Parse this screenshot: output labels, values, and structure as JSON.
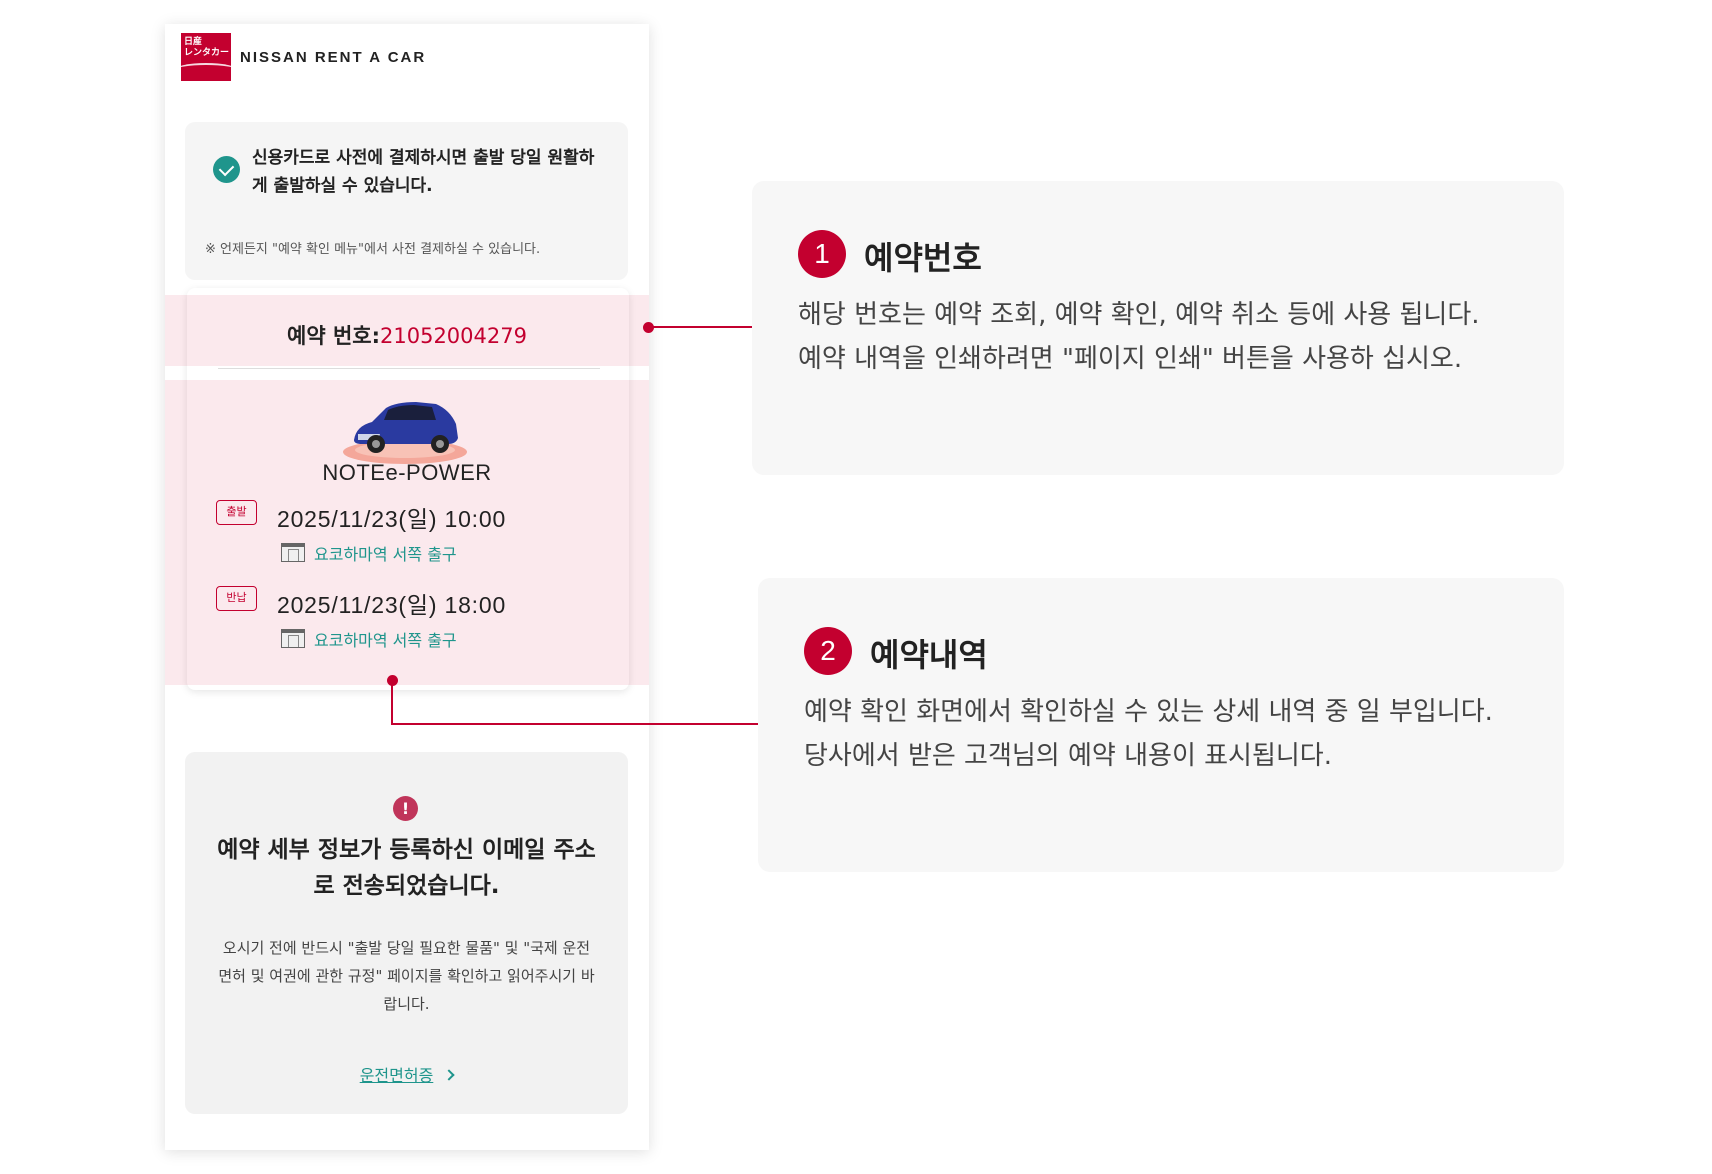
{
  "header": {
    "logo_text": "日産\nレンタカー",
    "brand": "NISSAN RENT A CAR"
  },
  "notice": {
    "title": "신용카드로 사전에 결제하시면 출발 당일 원활하게 출발하실 수 있습니다.",
    "note": "※ 언제든지 \"예약 확인 메뉴\"에서 사전 결제하실 수 있습니다."
  },
  "reservation": {
    "number_label": "예약 번호:",
    "number_value": "21052004279",
    "car_name": "NOTEe-POWER",
    "departure": {
      "tag": "출발",
      "datetime": "2025/11/23(일) 10:00",
      "store": "요코하마역 서쪽 출구"
    },
    "return": {
      "tag": "반납",
      "datetime": "2025/11/23(일) 18:00",
      "store": "요코하마역 서쪽 출구"
    }
  },
  "mail_notice": {
    "title": "예약 세부 정보가 등록하신 이메일 주소로 전송되었습니다.",
    "body": "오시기 전에 반드시 \"출발 당일 필요한 물품\" 및 \"국제 운전 면허 및 여권에 관한 규정\" 페이지를 확인하고 읽어주시기 바랍니다.",
    "link": "운전면허증"
  },
  "callouts": [
    {
      "badge": "1",
      "title": "예약번호",
      "body_line1": "해당 번호는 예약 조회, 예약 확인, 예약 취소 등에 사용 됩니다.",
      "body_line2": "예약 내역을 인쇄하려면 \"페이지 인쇄\" 버튼을 사용하 십시오."
    },
    {
      "badge": "2",
      "title": "예약내역",
      "body_line1": "예약 확인 화면에서 확인하실 수 있는 상세 내역 중 일 부입니다.",
      "body_line2": "당사에서 받은 고객님의 예약 내용이 표시됩니다."
    }
  ],
  "colors": {
    "brand_red": "#c3002f",
    "teal": "#1f958c",
    "highlight_band": "#fbe9ed"
  }
}
